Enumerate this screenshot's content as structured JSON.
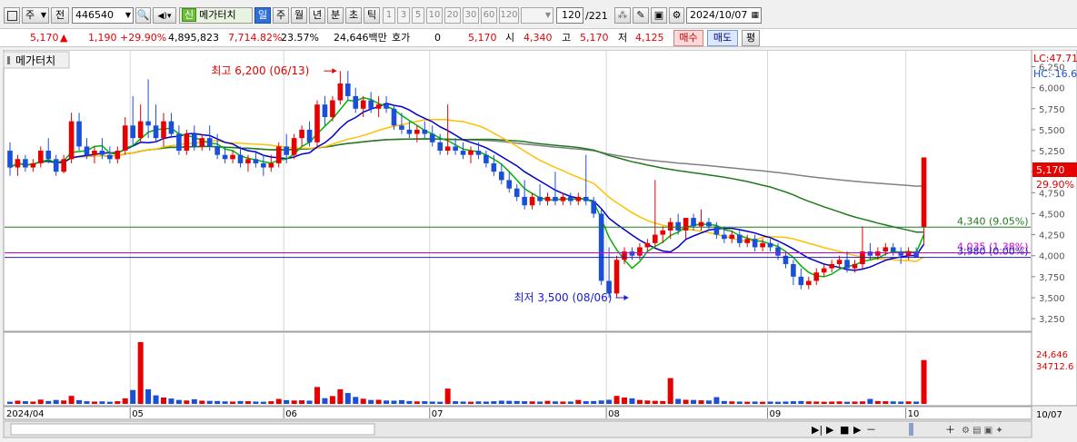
{
  "toolbar": {
    "market_select": "주",
    "prev_label": "전",
    "code": "446540",
    "name_badge": "신",
    "name": "메가터치",
    "period_tabs": [
      "일",
      "주",
      "월",
      "년",
      "분",
      "초",
      "틱"
    ],
    "active_period": "일",
    "minute_options": [
      "1",
      "3",
      "5",
      "10",
      "20",
      "30",
      "60",
      "120"
    ],
    "count_display": "120",
    "total_display": "/221",
    "date": "2024/10/07"
  },
  "quote": {
    "price": "5,170",
    "change": "1,190",
    "change_pct": "+29.90%",
    "volume": "4,895,823",
    "volume_ratio": "7,714.82%",
    "turnover": "23.57%",
    "amount": "24,646백만",
    "hoga_label": "호가",
    "hoga_value": "0",
    "hoga_price": "5,170",
    "open_label": "시",
    "open": "4,340",
    "high_label": "고",
    "high": "5,170",
    "low_label": "저",
    "low": "4,125",
    "buy_button": "매수",
    "sell_button": "매도",
    "eval_button": "평"
  },
  "colors": {
    "up": "#e60000",
    "down": "#1a4fd8",
    "ma5": "#00b400",
    "ma10": "#0000c8",
    "ma20": "#ffc000",
    "ma60": "#1e7a1e",
    "ma120": "#808080"
  },
  "chart_data": {
    "type": "candlestick",
    "title": "메가터치",
    "price_range": [
      3100,
      6450
    ],
    "volume_max": 34712.6,
    "y_ticks": [
      6250,
      6000,
      5750,
      5500,
      5250,
      5000,
      4750,
      4500,
      4250,
      4000,
      3750,
      3500,
      3250
    ],
    "y_tick_labels": [
      "6,250",
      "6,000",
      "5,750",
      "5,500",
      "5,250",
      "5,000",
      "4,750",
      "4,500",
      "4,250",
      "4,000",
      "3,750",
      "3,500",
      "3,250"
    ],
    "month_labels": [
      {
        "label": "2024/04",
        "index": 0
      },
      {
        "label": "05",
        "index": 16
      },
      {
        "label": "06",
        "index": 36
      },
      {
        "label": "07",
        "index": 55
      },
      {
        "label": "08",
        "index": 78
      },
      {
        "label": "09",
        "index": 99
      },
      {
        "label": "10",
        "index": 117
      }
    ],
    "bottom_right_label": "10/07",
    "top_right_labels": [
      "LC:47.71",
      "HC:-16.6"
    ],
    "last_price_box": {
      "value": "5,170",
      "pct": "29.90%"
    },
    "volume_labels": [
      "24,646",
      "34712.6"
    ],
    "horizontal_lines": [
      {
        "value": 4340,
        "label": "4,340 (9.05%)",
        "color": "#1e7a1e"
      },
      {
        "value": 4035,
        "label": "4,035 (1.38%)",
        "color": "#d000d0"
      },
      {
        "value": 3980,
        "label": "3,980 (0.00%)",
        "color": "#2020c0"
      }
    ],
    "high_annotation": {
      "text": "최고 6,200 (06/13)",
      "index": 43,
      "value": 6200
    },
    "low_annotation": {
      "text": "최저 3,500 (08/06)",
      "index": 81,
      "value": 3500
    },
    "candles": [
      {
        "o": 5250,
        "h": 5350,
        "l": 4950,
        "c": 5050
      },
      {
        "o": 5050,
        "h": 5200,
        "l": 4950,
        "c": 5150
      },
      {
        "o": 5150,
        "h": 5200,
        "l": 5000,
        "c": 5050
      },
      {
        "o": 5050,
        "h": 5150,
        "l": 5000,
        "c": 5100
      },
      {
        "o": 5100,
        "h": 5300,
        "l": 5050,
        "c": 5250
      },
      {
        "o": 5250,
        "h": 5400,
        "l": 5100,
        "c": 5150
      },
      {
        "o": 5150,
        "h": 5200,
        "l": 4950,
        "c": 5000
      },
      {
        "o": 5000,
        "h": 5200,
        "l": 4980,
        "c": 5150
      },
      {
        "o": 5150,
        "h": 5700,
        "l": 5100,
        "c": 5600
      },
      {
        "o": 5600,
        "h": 5700,
        "l": 5250,
        "c": 5300
      },
      {
        "o": 5300,
        "h": 5400,
        "l": 5150,
        "c": 5200
      },
      {
        "o": 5200,
        "h": 5300,
        "l": 5100,
        "c": 5250
      },
      {
        "o": 5250,
        "h": 5400,
        "l": 5150,
        "c": 5200
      },
      {
        "o": 5200,
        "h": 5300,
        "l": 5100,
        "c": 5150
      },
      {
        "o": 5150,
        "h": 5300,
        "l": 5100,
        "c": 5250
      },
      {
        "o": 5250,
        "h": 5650,
        "l": 5200,
        "c": 5550
      },
      {
        "o": 5550,
        "h": 5900,
        "l": 5300,
        "c": 5400
      },
      {
        "o": 5400,
        "h": 5800,
        "l": 5350,
        "c": 5600
      },
      {
        "o": 5600,
        "h": 6100,
        "l": 5400,
        "c": 5550
      },
      {
        "o": 5550,
        "h": 5800,
        "l": 5350,
        "c": 5400
      },
      {
        "o": 5400,
        "h": 5700,
        "l": 5300,
        "c": 5600
      },
      {
        "o": 5600,
        "h": 5700,
        "l": 5400,
        "c": 5450
      },
      {
        "o": 5450,
        "h": 5550,
        "l": 5200,
        "c": 5250
      },
      {
        "o": 5250,
        "h": 5500,
        "l": 5200,
        "c": 5450
      },
      {
        "o": 5450,
        "h": 5550,
        "l": 5250,
        "c": 5300
      },
      {
        "o": 5300,
        "h": 5450,
        "l": 5250,
        "c": 5400
      },
      {
        "o": 5400,
        "h": 5550,
        "l": 5250,
        "c": 5300
      },
      {
        "o": 5300,
        "h": 5450,
        "l": 5150,
        "c": 5200
      },
      {
        "o": 5200,
        "h": 5300,
        "l": 5100,
        "c": 5150
      },
      {
        "o": 5150,
        "h": 5250,
        "l": 5100,
        "c": 5200
      },
      {
        "o": 5200,
        "h": 5300,
        "l": 5050,
        "c": 5100
      },
      {
        "o": 5100,
        "h": 5200,
        "l": 5000,
        "c": 5150
      },
      {
        "o": 5150,
        "h": 5250,
        "l": 5050,
        "c": 5100
      },
      {
        "o": 5100,
        "h": 5200,
        "l": 4950,
        "c": 5050
      },
      {
        "o": 5050,
        "h": 5200,
        "l": 5000,
        "c": 5100
      },
      {
        "o": 5100,
        "h": 5350,
        "l": 5050,
        "c": 5300
      },
      {
        "o": 5300,
        "h": 5450,
        "l": 5100,
        "c": 5200
      },
      {
        "o": 5200,
        "h": 5450,
        "l": 5150,
        "c": 5400
      },
      {
        "o": 5400,
        "h": 5550,
        "l": 5300,
        "c": 5500
      },
      {
        "o": 5500,
        "h": 5600,
        "l": 5300,
        "c": 5350
      },
      {
        "o": 5350,
        "h": 5850,
        "l": 5300,
        "c": 5800
      },
      {
        "o": 5800,
        "h": 5900,
        "l": 5550,
        "c": 5650
      },
      {
        "o": 5650,
        "h": 5900,
        "l": 5600,
        "c": 5850
      },
      {
        "o": 5850,
        "h": 6200,
        "l": 5800,
        "c": 6050
      },
      {
        "o": 6050,
        "h": 6200,
        "l": 5850,
        "c": 5900
      },
      {
        "o": 5900,
        "h": 6000,
        "l": 5700,
        "c": 5750
      },
      {
        "o": 5750,
        "h": 5900,
        "l": 5650,
        "c": 5850
      },
      {
        "o": 5850,
        "h": 5950,
        "l": 5700,
        "c": 5750
      },
      {
        "o": 5750,
        "h": 5900,
        "l": 5650,
        "c": 5800
      },
      {
        "o": 5800,
        "h": 5900,
        "l": 5700,
        "c": 5750
      },
      {
        "o": 5750,
        "h": 5800,
        "l": 5500,
        "c": 5550
      },
      {
        "o": 5550,
        "h": 5700,
        "l": 5450,
        "c": 5500
      },
      {
        "o": 5500,
        "h": 5600,
        "l": 5400,
        "c": 5450
      },
      {
        "o": 5450,
        "h": 5550,
        "l": 5350,
        "c": 5500
      },
      {
        "o": 5500,
        "h": 5600,
        "l": 5400,
        "c": 5450
      },
      {
        "o": 5450,
        "h": 5550,
        "l": 5300,
        "c": 5350
      },
      {
        "o": 5350,
        "h": 5450,
        "l": 5200,
        "c": 5250
      },
      {
        "o": 5250,
        "h": 5800,
        "l": 5200,
        "c": 5300
      },
      {
        "o": 5300,
        "h": 5400,
        "l": 5200,
        "c": 5250
      },
      {
        "o": 5250,
        "h": 5350,
        "l": 5150,
        "c": 5200
      },
      {
        "o": 5200,
        "h": 5300,
        "l": 5100,
        "c": 5250
      },
      {
        "o": 5250,
        "h": 5350,
        "l": 5150,
        "c": 5200
      },
      {
        "o": 5200,
        "h": 5250,
        "l": 5050,
        "c": 5100
      },
      {
        "o": 5100,
        "h": 5200,
        "l": 4950,
        "c": 5000
      },
      {
        "o": 5000,
        "h": 5100,
        "l": 4850,
        "c": 4900
      },
      {
        "o": 4900,
        "h": 5000,
        "l": 4750,
        "c": 4800
      },
      {
        "o": 4800,
        "h": 4850,
        "l": 4650,
        "c": 4700
      },
      {
        "o": 4700,
        "h": 4900,
        "l": 4550,
        "c": 4600
      },
      {
        "o": 4600,
        "h": 4750,
        "l": 4550,
        "c": 4700
      },
      {
        "o": 4700,
        "h": 4850,
        "l": 4600,
        "c": 4650
      },
      {
        "o": 4650,
        "h": 4750,
        "l": 4600,
        "c": 4700
      },
      {
        "o": 4700,
        "h": 5000,
        "l": 4600,
        "c": 4650
      },
      {
        "o": 4650,
        "h": 4750,
        "l": 4600,
        "c": 4700
      },
      {
        "o": 4700,
        "h": 4750,
        "l": 4600,
        "c": 4650
      },
      {
        "o": 4650,
        "h": 4750,
        "l": 4600,
        "c": 4700
      },
      {
        "o": 4700,
        "h": 5200,
        "l": 4600,
        "c": 4650
      },
      {
        "o": 4650,
        "h": 4700,
        "l": 4450,
        "c": 4500
      },
      {
        "o": 4500,
        "h": 4550,
        "l": 3650,
        "c": 3700
      },
      {
        "o": 3700,
        "h": 4100,
        "l": 3500,
        "c": 3550
      },
      {
        "o": 3550,
        "h": 4000,
        "l": 3500,
        "c": 3950
      },
      {
        "o": 3950,
        "h": 4100,
        "l": 3900,
        "c": 4050
      },
      {
        "o": 4050,
        "h": 4100,
        "l": 3950,
        "c": 4000
      },
      {
        "o": 4000,
        "h": 4150,
        "l": 3950,
        "c": 4100
      },
      {
        "o": 4100,
        "h": 4200,
        "l": 4050,
        "c": 4150
      },
      {
        "o": 4150,
        "h": 4900,
        "l": 4100,
        "c": 4250
      },
      {
        "o": 4250,
        "h": 4350,
        "l": 4150,
        "c": 4300
      },
      {
        "o": 4300,
        "h": 4450,
        "l": 4200,
        "c": 4400
      },
      {
        "o": 4400,
        "h": 4500,
        "l": 4250,
        "c": 4300
      },
      {
        "o": 4300,
        "h": 4450,
        "l": 4200,
        "c": 4450
      },
      {
        "o": 4450,
        "h": 4500,
        "l": 4300,
        "c": 4350
      },
      {
        "o": 4350,
        "h": 4550,
        "l": 4300,
        "c": 4400
      },
      {
        "o": 4400,
        "h": 4450,
        "l": 4300,
        "c": 4350
      },
      {
        "o": 4350,
        "h": 4400,
        "l": 4200,
        "c": 4250
      },
      {
        "o": 4250,
        "h": 4350,
        "l": 4150,
        "c": 4200
      },
      {
        "o": 4200,
        "h": 4300,
        "l": 4150,
        "c": 4250
      },
      {
        "o": 4250,
        "h": 4300,
        "l": 4100,
        "c": 4150
      },
      {
        "o": 4150,
        "h": 4250,
        "l": 4100,
        "c": 4200
      },
      {
        "o": 4200,
        "h": 4250,
        "l": 4050,
        "c": 4100
      },
      {
        "o": 4100,
        "h": 4200,
        "l": 4050,
        "c": 4150
      },
      {
        "o": 4150,
        "h": 4200,
        "l": 4050,
        "c": 4100
      },
      {
        "o": 4100,
        "h": 4150,
        "l": 3950,
        "c": 4000
      },
      {
        "o": 4000,
        "h": 4050,
        "l": 3850,
        "c": 3900
      },
      {
        "o": 3900,
        "h": 3950,
        "l": 3650,
        "c": 3750
      },
      {
        "o": 3750,
        "h": 3850,
        "l": 3600,
        "c": 3650
      },
      {
        "o": 3650,
        "h": 3750,
        "l": 3600,
        "c": 3700
      },
      {
        "o": 3700,
        "h": 3850,
        "l": 3650,
        "c": 3800
      },
      {
        "o": 3800,
        "h": 3900,
        "l": 3750,
        "c": 3850
      },
      {
        "o": 3850,
        "h": 3950,
        "l": 3800,
        "c": 3900
      },
      {
        "o": 3900,
        "h": 4000,
        "l": 3850,
        "c": 3950
      },
      {
        "o": 3950,
        "h": 4050,
        "l": 3800,
        "c": 3850
      },
      {
        "o": 3850,
        "h": 3950,
        "l": 3800,
        "c": 3900
      },
      {
        "o": 3900,
        "h": 4350,
        "l": 3850,
        "c": 4050
      },
      {
        "o": 4050,
        "h": 4150,
        "l": 3950,
        "c": 4000
      },
      {
        "o": 4000,
        "h": 4100,
        "l": 3950,
        "c": 4050
      },
      {
        "o": 4050,
        "h": 4150,
        "l": 4000,
        "c": 4100
      },
      {
        "o": 4100,
        "h": 4150,
        "l": 4000,
        "c": 4050
      },
      {
        "o": 4050,
        "h": 4100,
        "l": 3900,
        "c": 4000
      },
      {
        "o": 4000,
        "h": 4100,
        "l": 3950,
        "c": 4050
      },
      {
        "o": 4050,
        "h": 4100,
        "l": 3980,
        "c": 3980
      },
      {
        "o": 4340,
        "h": 5170,
        "l": 4125,
        "c": 5170
      }
    ],
    "volumes": [
      1200,
      1800,
      1500,
      1300,
      2400,
      1600,
      2200,
      1900,
      4500,
      2100,
      1500,
      1300,
      1400,
      1200,
      1500,
      3100,
      7800,
      34712,
      8200,
      4800,
      3600,
      3000,
      2200,
      1900,
      2600,
      1800,
      1700,
      1600,
      1400,
      1300,
      1600,
      1500,
      1300,
      1200,
      1500,
      2800,
      2100,
      1900,
      2000,
      1800,
      9500,
      3200,
      4400,
      8200,
      6100,
      3900,
      2900,
      2200,
      2300,
      1900,
      1800,
      2100,
      1600,
      1400,
      1500,
      1300,
      1200,
      8600,
      1500,
      1300,
      1200,
      1400,
      1300,
      1500,
      1800,
      1700,
      1600,
      1500,
      1400,
      1300,
      1700,
      1400,
      1300,
      1300,
      2200,
      1500,
      1600,
      1900,
      2300,
      4500,
      3600,
      3100,
      2200,
      1900,
      1700,
      1600,
      14500,
      2800,
      2300,
      2200,
      2000,
      1900,
      3800,
      1600,
      1400,
      1300,
      1200,
      1300,
      1200,
      1300,
      1200,
      1300,
      1500,
      1600,
      1400,
      1300,
      1200,
      1300,
      1400,
      1200,
      1300,
      1400,
      2800,
      1600,
      1500,
      1400,
      1300,
      1400,
      1300,
      24646
    ]
  }
}
